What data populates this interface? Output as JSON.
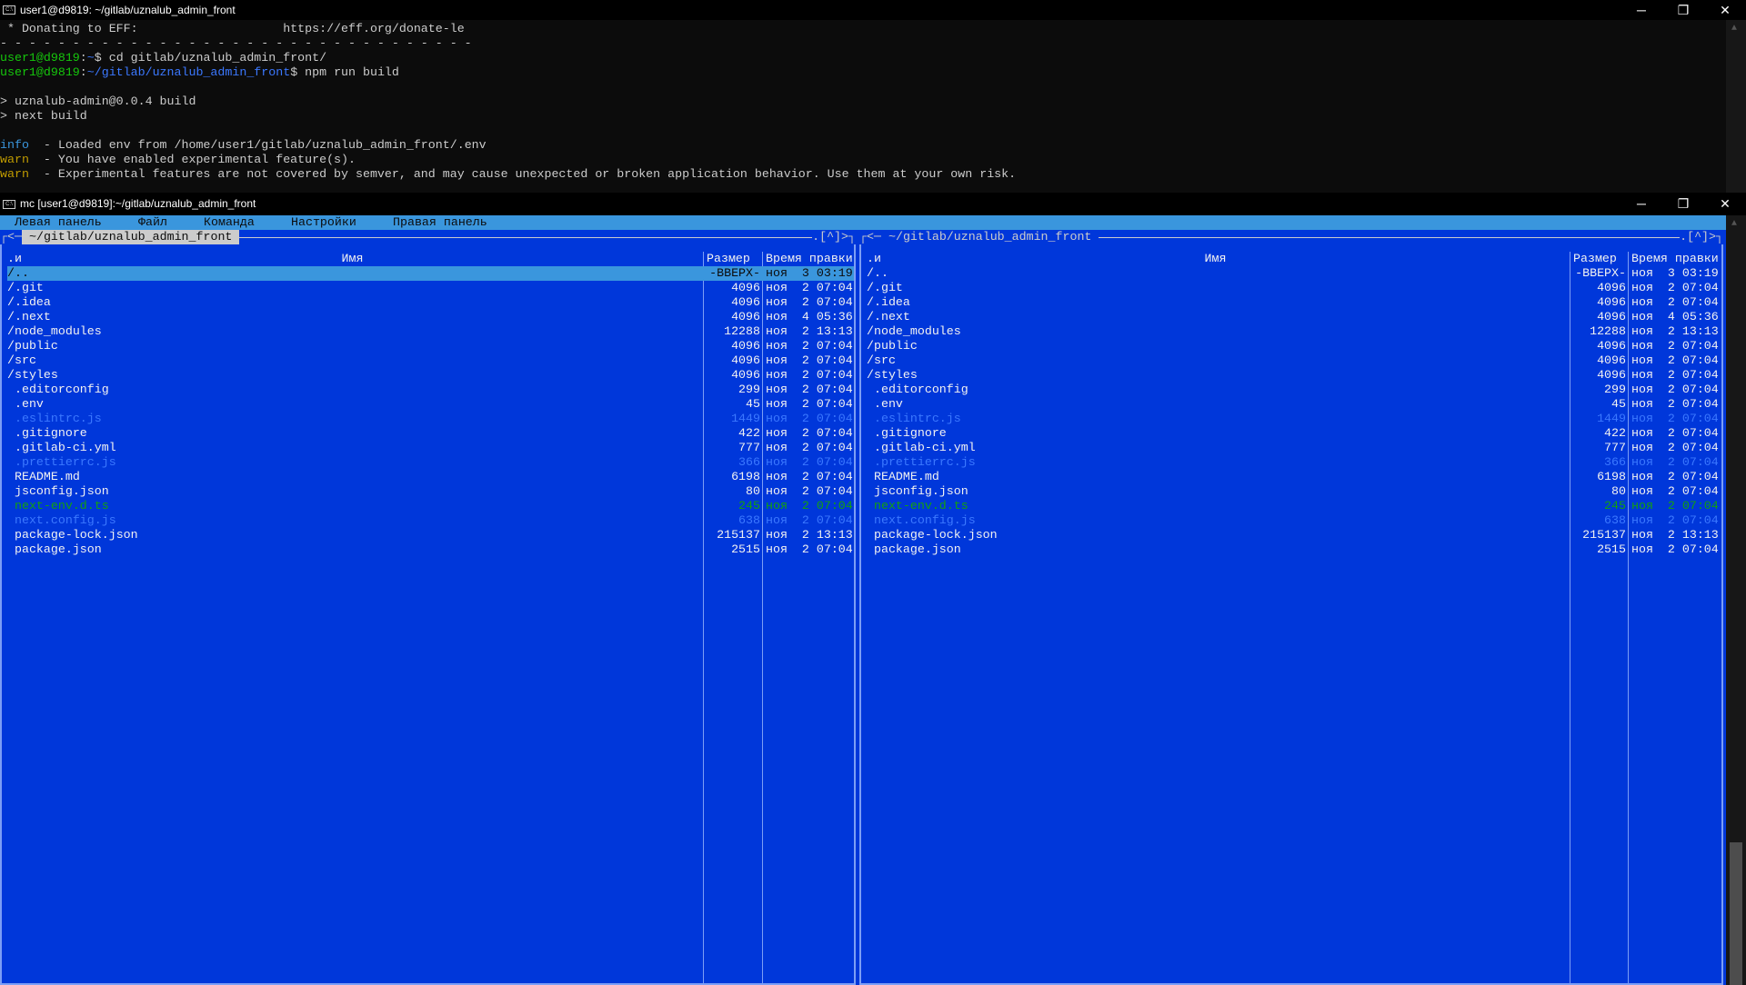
{
  "top_window": {
    "title": "user1@d9819: ~/gitlab/uznalub_admin_front",
    "lines": [
      [
        {
          "t": " * Donating to EFF:                    https://eff.org/donate-le",
          "c": ""
        }
      ],
      [
        {
          "t": "- - - - - - - - - - - - - - - - - - - - - - - - - - - - - - - - -",
          "c": ""
        }
      ],
      [
        {
          "t": "user1@d9819",
          "c": "g"
        },
        {
          "t": ":",
          "c": ""
        },
        {
          "t": "~",
          "c": "b"
        },
        {
          "t": "$ cd gitlab/uznalub_admin_front/",
          "c": ""
        }
      ],
      [
        {
          "t": "user1@d9819",
          "c": "g"
        },
        {
          "t": ":",
          "c": ""
        },
        {
          "t": "~/gitlab/uznalub_admin_front",
          "c": "b"
        },
        {
          "t": "$ npm run build",
          "c": ""
        }
      ],
      [],
      [
        {
          "t": "> uznalub-admin@0.0.4 build",
          "c": ""
        }
      ],
      [
        {
          "t": "> next build",
          "c": ""
        }
      ],
      [],
      [
        {
          "t": "info",
          "c": "info"
        },
        {
          "t": "  - Loaded env from /home/user1/gitlab/uznalub_admin_front/.env",
          "c": ""
        }
      ],
      [
        {
          "t": "warn",
          "c": "warn"
        },
        {
          "t": "  - You have enabled experimental feature(s).",
          "c": ""
        }
      ],
      [
        {
          "t": "warn",
          "c": "warn"
        },
        {
          "t": "  - Experimental features are not covered by semver, and may cause unexpected or broken application behavior. Use them at your own risk.",
          "c": ""
        }
      ]
    ]
  },
  "mc_window": {
    "title": "mc [user1@d9819]:~/gitlab/uznalub_admin_front"
  },
  "window_buttons": {
    "minimize": "─",
    "restore": "❐",
    "close": "✕"
  },
  "menu": [
    "Левая панель",
    "Файл",
    "Команда",
    "Настройки",
    "Правая панель"
  ],
  "panels": [
    {
      "path": " ~/gitlab/uznalub_admin_front ",
      "active": true,
      "left_corner": "┌<─",
      "right_corner": ".[^]>┐"
    },
    {
      "path": " ~/gitlab/uznalub_admin_front ",
      "active": false,
      "left_corner": "┌<─",
      "right_corner": ".[^]>┐"
    }
  ],
  "columns": {
    "sort": ".и",
    "name": "Имя",
    "size": "Размер",
    "date": "Время правки"
  },
  "files": [
    {
      "name": "/..",
      "size": "-ВВЕРХ-",
      "date": "ноя  3 03:19",
      "style": "dir"
    },
    {
      "name": "/.git",
      "size": "4096",
      "date": "ноя  2 07:04",
      "style": "dir"
    },
    {
      "name": "/.idea",
      "size": "4096",
      "date": "ноя  2 07:04",
      "style": "dir"
    },
    {
      "name": "/.next",
      "size": "4096",
      "date": "ноя  4 05:36",
      "style": "dir"
    },
    {
      "name": "/node_modules",
      "size": "12288",
      "date": "ноя  2 13:13",
      "style": "dir"
    },
    {
      "name": "/public",
      "size": "4096",
      "date": "ноя  2 07:04",
      "style": "dir"
    },
    {
      "name": "/src",
      "size": "4096",
      "date": "ноя  2 07:04",
      "style": "dir"
    },
    {
      "name": "/styles",
      "size": "4096",
      "date": "ноя  2 07:04",
      "style": "dir"
    },
    {
      "name": " .editorconfig",
      "size": "299",
      "date": "ноя  2 07:04",
      "style": "file"
    },
    {
      "name": " .env",
      "size": "45",
      "date": "ноя  2 07:04",
      "style": "file"
    },
    {
      "name": " .eslintrc.js",
      "size": "1449",
      "date": "ноя  2 07:04",
      "style": "dim"
    },
    {
      "name": " .gitignore",
      "size": "422",
      "date": "ноя  2 07:04",
      "style": "file"
    },
    {
      "name": " .gitlab-ci.yml",
      "size": "777",
      "date": "ноя  2 07:04",
      "style": "file"
    },
    {
      "name": " .prettierrc.js",
      "size": "366",
      "date": "ноя  2 07:04",
      "style": "dim"
    },
    {
      "name": " README.md",
      "size": "6198",
      "date": "ноя  2 07:04",
      "style": "file"
    },
    {
      "name": " jsconfig.json",
      "size": "80",
      "date": "ноя  2 07:04",
      "style": "file"
    },
    {
      "name": " next-env.d.ts",
      "size": "245",
      "date": "ноя  2 07:04",
      "style": "green"
    },
    {
      "name": " next.config.js",
      "size": "638",
      "date": "ноя  2 07:04",
      "style": "dim"
    },
    {
      "name": " package-lock.json",
      "size": "215137",
      "date": "ноя  2 13:13",
      "style": "file"
    },
    {
      "name": " package.json",
      "size": "2515",
      "date": "ноя  2 07:04",
      "style": "file"
    }
  ],
  "cursor_index": 0,
  "colors": {
    "panel_bg": "#0037da",
    "selection": "#3a96dd",
    "dim": "#3b78ff",
    "green": "#13a10e"
  }
}
